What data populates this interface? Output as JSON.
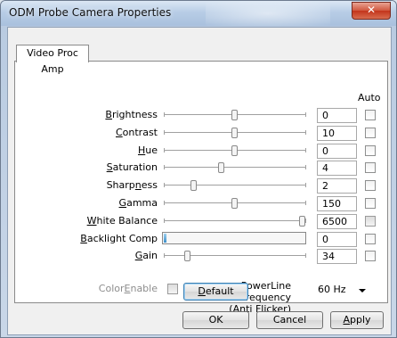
{
  "window": {
    "title": "ODM Probe Camera Properties",
    "close_glyph": "✕"
  },
  "tab": {
    "label": "Video Proc Amp"
  },
  "auto_header": "Auto",
  "controls": [
    {
      "label": "Brightness",
      "mnemonic_index": 0,
      "value": "0",
      "slider_fraction": 0.5,
      "auto": false
    },
    {
      "label": "Contrast",
      "mnemonic_index": 0,
      "value": "10",
      "slider_fraction": 0.5,
      "auto": false
    },
    {
      "label": "Hue",
      "mnemonic_index": 0,
      "value": "0",
      "slider_fraction": 0.5,
      "auto": false
    },
    {
      "label": "Saturation",
      "mnemonic_index": 0,
      "value": "4",
      "slider_fraction": 0.4,
      "auto": false
    },
    {
      "label": "Sharpness",
      "mnemonic_index": 5,
      "value": "2",
      "slider_fraction": 0.2,
      "auto": false
    },
    {
      "label": "Gamma",
      "mnemonic_index": 0,
      "value": "150",
      "slider_fraction": 0.5,
      "auto": false
    },
    {
      "label": "White Balance",
      "mnemonic_index": 0,
      "value": "6500",
      "slider_fraction": 1.0,
      "auto": false,
      "auto_greyed": true
    },
    {
      "label": "Backlight Comp",
      "mnemonic_index": 0,
      "value": "0",
      "bar_fraction": 0.0,
      "auto": false
    },
    {
      "label": "Gain",
      "mnemonic_index": 0,
      "value": "34",
      "slider_fraction": 0.15,
      "auto": false
    }
  ],
  "color_enable": {
    "label": "ColorEnable",
    "mnemonic_index": 5,
    "checked": false
  },
  "powerline": {
    "label_line1": "PowerLine Frequency",
    "label_line2": "(Anti Flicker)",
    "mnemonic_index": 0,
    "selected": "60 Hz"
  },
  "buttons": {
    "default": "Default",
    "ok": "OK",
    "cancel": "Cancel",
    "apply": "Apply"
  },
  "colors": {
    "title_bg": "#b8cde6",
    "close_red": "#c3341b",
    "focus_blue": "#3c7fb1",
    "bar_blue": "#3c8fc9"
  }
}
